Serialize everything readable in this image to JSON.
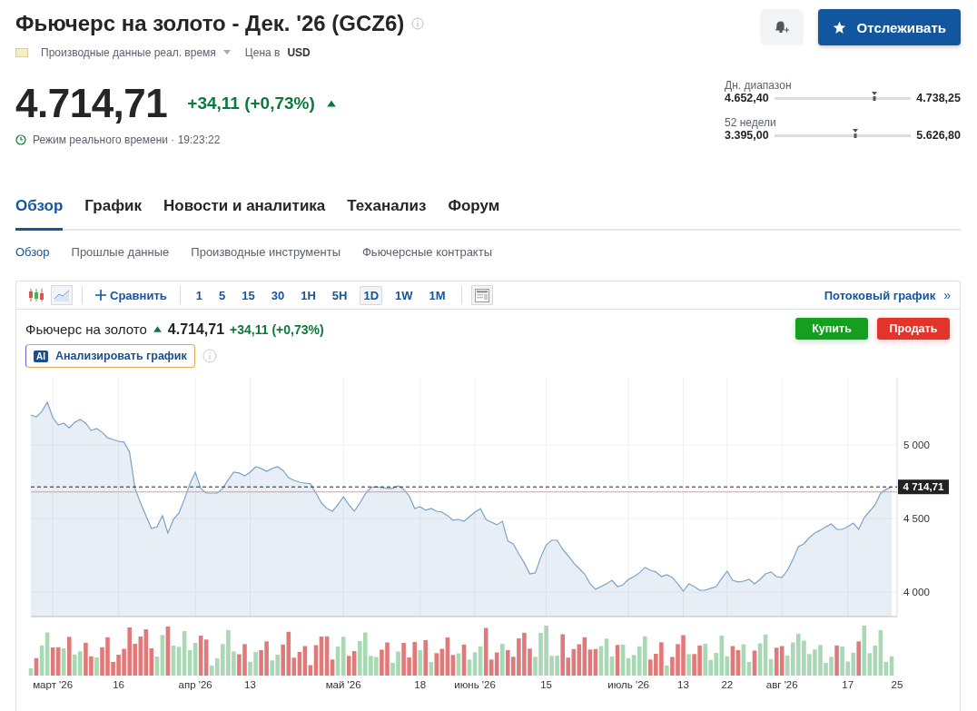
{
  "header": {
    "title": "Фьючерс на золото - Дек. '26 (GCZ6)",
    "data_source": "Производные данные реал. время",
    "currency_label": "Цена в",
    "currency": "USD",
    "watch_button": "Отслеживать"
  },
  "quote": {
    "price": "4.714,71",
    "change": "+34,11 (+0,73%)",
    "up": true,
    "status": "Режим реального времени · 19:23:22"
  },
  "ranges": [
    {
      "label": "Дн. диапазон",
      "low": "4.652,40",
      "high": "4.738,25",
      "level": 0.73
    },
    {
      "label": "52 недели",
      "low": "3.395,00",
      "high": "5.626,80",
      "level": 0.59
    }
  ],
  "tabs": [
    {
      "label": "Обзор",
      "selected": true
    },
    {
      "label": "График",
      "selected": false
    },
    {
      "label": "Новости и аналитика",
      "selected": false
    },
    {
      "label": "Теханализ",
      "selected": false
    },
    {
      "label": "Форум",
      "selected": false
    }
  ],
  "subtabs": [
    {
      "label": "Обзор",
      "selected": true
    },
    {
      "label": "Прошлые данные",
      "selected": false
    },
    {
      "label": "Производные инструменты",
      "selected": false
    },
    {
      "label": "Фьючерсные контракты",
      "selected": false
    }
  ],
  "chart_panel": {
    "toolbar": {
      "chart_types": [
        {
          "kind": "candles",
          "selected": false
        },
        {
          "kind": "area",
          "selected": true
        }
      ],
      "compare": "Сравнить",
      "intervals": [
        {
          "label": "1",
          "selected": false
        },
        {
          "label": "5",
          "selected": false
        },
        {
          "label": "15",
          "selected": false
        },
        {
          "label": "30",
          "selected": false
        },
        {
          "label": "1H",
          "selected": false
        },
        {
          "label": "5H",
          "selected": false
        },
        {
          "label": "1D",
          "selected": true
        },
        {
          "label": "1W",
          "selected": false
        },
        {
          "label": "1M",
          "selected": false
        }
      ],
      "stream_link": "Потоковый график",
      "stream_arrow": "»"
    },
    "price": "4.714,71",
    "change": "+34,11 (+0,73%)",
    "up": true,
    "buy_button": "Купить",
    "sell_button": "Продать",
    "ai_badge": "AI",
    "ai_button": "Анализировать график",
    "chart_data": {
      "type": "area",
      "grid": true,
      "ylim": [
        3833,
        5457
      ],
      "categories": [
        null,
        null,
        null,
        null,
        "март '26",
        null,
        null,
        null,
        null,
        null,
        null,
        null,
        null,
        null,
        null,
        null,
        "16",
        null,
        null,
        null,
        null,
        null,
        null,
        null,
        null,
        null,
        null,
        null,
        null,
        null,
        "апр '26",
        null,
        null,
        null,
        null,
        null,
        null,
        null,
        null,
        null,
        "13",
        null,
        null,
        null,
        null,
        null,
        null,
        null,
        null,
        null,
        null,
        null,
        null,
        null,
        null,
        null,
        null,
        "май '26",
        null,
        null,
        null,
        null,
        null,
        null,
        null,
        null,
        null,
        null,
        null,
        null,
        null,
        "18",
        null,
        null,
        null,
        null,
        null,
        null,
        null,
        null,
        null,
        "июнь '26",
        null,
        null,
        null,
        null,
        null,
        null,
        null,
        null,
        null,
        null,
        null,
        null,
        "15",
        null,
        null,
        null,
        null,
        null,
        null,
        null,
        null,
        null,
        null,
        null,
        null,
        null,
        null,
        "июль '26",
        null,
        null,
        null,
        null,
        null,
        null,
        null,
        null,
        null,
        "13",
        null,
        null,
        null,
        null,
        null,
        null,
        null,
        "22",
        null,
        null,
        null,
        null,
        null,
        null,
        null,
        null,
        null,
        "авг '26",
        null,
        null,
        null,
        null,
        null,
        null,
        null,
        null,
        null,
        null,
        null,
        "17",
        null,
        null,
        null,
        null,
        null,
        null,
        null,
        null,
        "25"
      ],
      "yticks": [
        {
          "value": 4000,
          "label": "4 000"
        },
        {
          "value": 4500,
          "label": "4 500"
        },
        {
          "value": 5000,
          "label": "5 000"
        }
      ],
      "series": [
        {
          "name": "Фьючерс на золото",
          "color": "#7ba3c8",
          "values": [
            5204,
            5191,
            5228,
            5290,
            5185,
            5136,
            5148,
            5117,
            5154,
            5173,
            5148,
            5099,
            5111,
            5086,
            5049,
            5037,
            5025,
            5019,
            4951,
            4704,
            4605,
            4519,
            4432,
            4444,
            4519,
            4401,
            4494,
            4537,
            4630,
            4735,
            4815,
            4704,
            4673,
            4673,
            4673,
            4704,
            4765,
            4815,
            4809,
            4790,
            4815,
            4852,
            4840,
            4821,
            4840,
            4852,
            4827,
            4778,
            4759,
            4747,
            4741,
            4735,
            4673,
            4605,
            4568,
            4549,
            4593,
            4648,
            4593,
            4549,
            4605,
            4667,
            4710,
            4716,
            4710,
            4704,
            4704,
            4722,
            4698,
            4654,
            4568,
            4580,
            4556,
            4568,
            4549,
            4543,
            4519,
            4488,
            4494,
            4481,
            4512,
            4543,
            4568,
            4494,
            4475,
            4457,
            4481,
            4346,
            4327,
            4259,
            4198,
            4123,
            4130,
            4235,
            4321,
            4352,
            4352,
            4290,
            4247,
            4198,
            4160,
            4123,
            4056,
            4019,
            4037,
            4056,
            4080,
            4037,
            4049,
            4086,
            4105,
            4130,
            4167,
            4148,
            4136,
            4105,
            4117,
            4099,
            4056,
            4006,
            4056,
            4037,
            4012,
            4012,
            4025,
            4037,
            4093,
            4142,
            4080,
            4068,
            4074,
            4086,
            4056,
            4086,
            4123,
            4136,
            4105,
            4099,
            4148,
            4222,
            4309,
            4327,
            4370,
            4401,
            4420,
            4444,
            4463,
            4426,
            4426,
            4444,
            4469,
            4426,
            4506,
            4549,
            4593,
            4673,
            4698,
            4715,
            null
          ]
        }
      ],
      "ref_lines": [
        {
          "axis": "y",
          "value": 4714.71,
          "label": "4 714,71",
          "color": "#222222"
        },
        {
          "axis": "y",
          "value": 4680.6,
          "color": "#e79a94"
        }
      ]
    }
  }
}
